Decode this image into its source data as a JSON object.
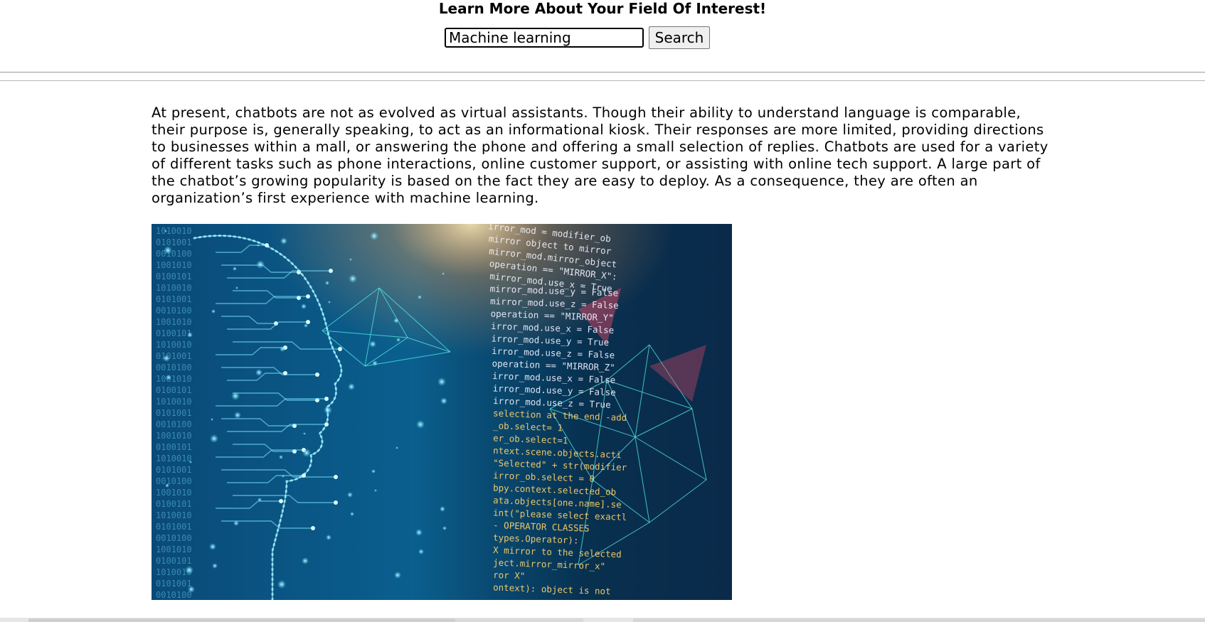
{
  "header": {
    "title": "Learn More About Your Field Of Interest!",
    "search": {
      "value": "Machine learning",
      "button_label": "Search"
    }
  },
  "article": {
    "text": "At present, chatbots are not as evolved as virtual assistants. Though their ability to understand language is comparable, their purpose is, generally speaking, to act as an informational kiosk. Their responses are more limited, providing directions to businesses within a mall, or answering the phone and offering a small selection of replies. Chatbots are used for a variety of different tasks such as phone interactions, online customer support, or assisting with online tech support. A large part of the chatbot’s growing popularity is based on the fact they are easy to deploy. As a consequence, they are often an organization’s first experience with machine learning.",
    "image": {
      "code_lines": [
        "irror_mod = modifier_ob",
        "mirror object to mirror",
        "mirror_mod.mirror_object",
        "operation == \"MIRROR_X\":",
        "mirror_mod.use_x = True",
        "mirror_mod.use_y = False",
        "mirror_mod.use_z = False",
        "operation == \"MIRROR_Y\"",
        "irror_mod.use_x = False",
        "irror_mod.use_y = True",
        "irror_mod.use_z = False",
        "operation == \"MIRROR_Z\"",
        "irror_mod.use_x = False",
        "irror_mod.use_y = False",
        "irror_mod.use_z = True",
        "selection at the end -add",
        "_ob.select= 1",
        "er_ob.select=1",
        "ntext.scene.objects.acti",
        "\"Selected\" + str(modifier",
        "irror_ob.select = 0",
        "bpy.context.selected_ob",
        "ata.objects[one.name].se",
        "int(\"please select exactl",
        "- OPERATOR CLASSES",
        "types.Operator):",
        "X mirror to the selected",
        "ject.mirror_mirror_x\"",
        "ror X\"",
        "ontext): object is not"
      ],
      "colors": {
        "background": "#06324f",
        "glow": "#7fe8ff",
        "code": "#ffd36b",
        "accent": "#e84a6a"
      }
    }
  }
}
